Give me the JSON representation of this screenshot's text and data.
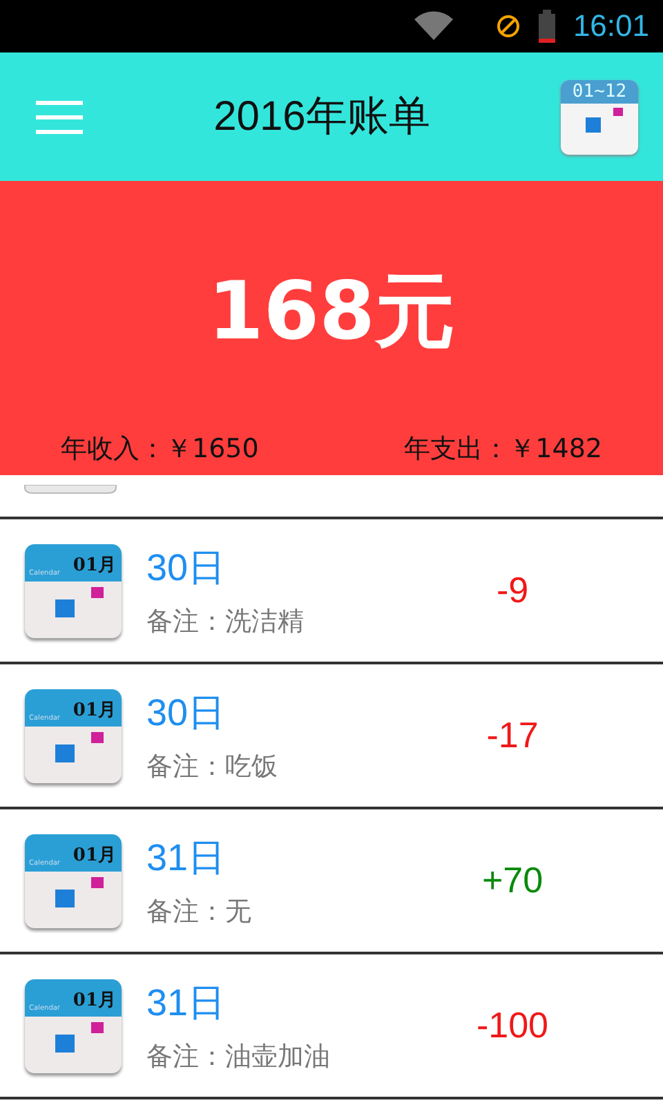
{
  "status_bar": {
    "time": "16:01"
  },
  "header": {
    "title": "2016年账单",
    "calendar_icon_label": "01~12"
  },
  "summary": {
    "total": "168元",
    "income": "年收入：￥1650",
    "expense": "年支出：￥1482"
  },
  "records": [
    {
      "icon_month": "01月",
      "icon_caption": "Calendar",
      "day": "30日",
      "note": "备注：洗洁精",
      "amount": "-9",
      "kind": "expense"
    },
    {
      "icon_month": "01月",
      "icon_caption": "Calendar",
      "day": "30日",
      "note": "备注：吃饭",
      "amount": "-17",
      "kind": "expense"
    },
    {
      "icon_month": "01月",
      "icon_caption": "Calendar",
      "day": "31日",
      "note": "备注：无",
      "amount": "+70",
      "kind": "income"
    },
    {
      "icon_month": "01月",
      "icon_caption": "Calendar",
      "day": "31日",
      "note": "备注：油壶加油",
      "amount": "-100",
      "kind": "expense"
    }
  ]
}
